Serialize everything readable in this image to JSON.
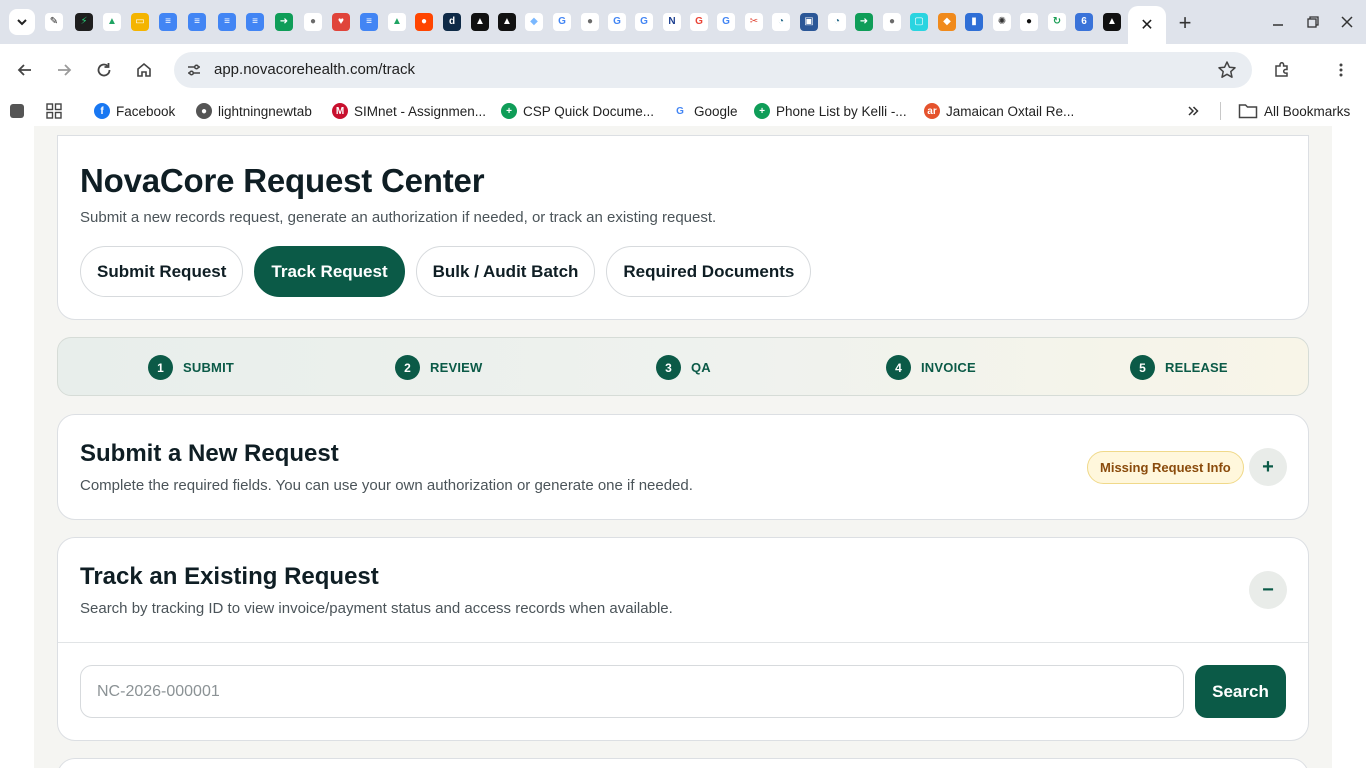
{
  "browser": {
    "tab_favicons": [
      {
        "name": "script-app-icon",
        "glyph": "✎",
        "bg": "#ffffff",
        "fg": "#222222"
      },
      {
        "name": "bolt-app-icon",
        "glyph": "⚡",
        "bg": "#1e1e1e",
        "fg": "#29d17a"
      },
      {
        "name": "google-drive-icon",
        "glyph": "▲",
        "bg": "#ffffff",
        "fg": "#1fa463"
      },
      {
        "name": "google-slides-icon",
        "glyph": "▭",
        "bg": "#f4b400",
        "fg": "#ffffff"
      },
      {
        "name": "google-docs-icon",
        "glyph": "≡",
        "bg": "#4285f4",
        "fg": "#ffffff"
      },
      {
        "name": "google-docs-icon",
        "glyph": "≡",
        "bg": "#4285f4",
        "fg": "#ffffff"
      },
      {
        "name": "google-docs-icon",
        "glyph": "≡",
        "bg": "#4285f4",
        "fg": "#ffffff"
      },
      {
        "name": "google-docs-icon",
        "glyph": "≡",
        "bg": "#4285f4",
        "fg": "#ffffff"
      },
      {
        "name": "google-meet-icon",
        "glyph": "➜",
        "bg": "#0f9d58",
        "fg": "#ffffff"
      },
      {
        "name": "globe-icon",
        "glyph": "●",
        "bg": "#ffffff",
        "fg": "#6b6b6b"
      },
      {
        "name": "calendar-heart-icon",
        "glyph": "♥",
        "bg": "#e0443a",
        "fg": "#ffffff"
      },
      {
        "name": "google-docs-icon",
        "glyph": "≡",
        "bg": "#4285f4",
        "fg": "#ffffff"
      },
      {
        "name": "google-drive-icon",
        "glyph": "▲",
        "bg": "#ffffff",
        "fg": "#1fa463"
      },
      {
        "name": "reddit-icon",
        "glyph": "●",
        "bg": "#ff4500",
        "fg": "#ffffff"
      },
      {
        "name": "d-app-icon",
        "glyph": "d",
        "bg": "#0e2a47",
        "fg": "#ffffff"
      },
      {
        "name": "triangle-app-icon",
        "glyph": "▲",
        "bg": "#111111",
        "fg": "#ffffff"
      },
      {
        "name": "triangle-app-icon",
        "glyph": "▲",
        "bg": "#111111",
        "fg": "#ffffff"
      },
      {
        "name": "gem-app-icon",
        "glyph": "◆",
        "bg": "#ffffff",
        "fg": "#7ab8ff"
      },
      {
        "name": "google-icon",
        "glyph": "G",
        "bg": "#ffffff",
        "fg": "#4285f4"
      },
      {
        "name": "globe-icon",
        "glyph": "●",
        "bg": "#ffffff",
        "fg": "#6b6b6b"
      },
      {
        "name": "google-icon",
        "glyph": "G",
        "bg": "#ffffff",
        "fg": "#4285f4"
      },
      {
        "name": "google-icon",
        "glyph": "G",
        "bg": "#ffffff",
        "fg": "#4285f4"
      },
      {
        "name": "n-app-icon",
        "glyph": "N",
        "bg": "#ffffff",
        "fg": "#1a3d8f"
      },
      {
        "name": "google-icon",
        "glyph": "G",
        "bg": "#ffffff",
        "fg": "#ea4335"
      },
      {
        "name": "google-icon",
        "glyph": "G",
        "bg": "#ffffff",
        "fg": "#4285f4"
      },
      {
        "name": "scissors-app-icon",
        "glyph": "✂",
        "bg": "#ffffff",
        "fg": "#e04a3a"
      },
      {
        "name": "gauge-app-icon",
        "glyph": "◔",
        "bg": "#ffffff",
        "fg": "#2e6f8e"
      },
      {
        "name": "window-app-icon",
        "glyph": "▣",
        "bg": "#2b5797",
        "fg": "#ffffff"
      },
      {
        "name": "gauge-app-icon",
        "glyph": "◔",
        "bg": "#ffffff",
        "fg": "#2e6f8e"
      },
      {
        "name": "google-meet-icon",
        "glyph": "➜",
        "bg": "#0f9d58",
        "fg": "#ffffff"
      },
      {
        "name": "globe-icon",
        "glyph": "●",
        "bg": "#ffffff",
        "fg": "#6b6b6b"
      },
      {
        "name": "square-app-icon",
        "glyph": "▢",
        "bg": "#2ad4e0",
        "fg": "#ffffff"
      },
      {
        "name": "box-app-icon",
        "glyph": "◆",
        "bg": "#f08a1c",
        "fg": "#ffffff"
      },
      {
        "name": "bookmark-app-icon",
        "glyph": "▮",
        "bg": "#2f6fd6",
        "fg": "#ffffff"
      },
      {
        "name": "openai-icon",
        "glyph": "✺",
        "bg": "#ffffff",
        "fg": "#333333"
      },
      {
        "name": "github-icon",
        "glyph": "●",
        "bg": "#ffffff",
        "fg": "#111111"
      },
      {
        "name": "refresh-app-icon",
        "glyph": "↻",
        "bg": "#ffffff",
        "fg": "#1a9e55"
      },
      {
        "name": "six-app-icon",
        "glyph": "6",
        "bg": "#3a73d9",
        "fg": "#ffffff"
      },
      {
        "name": "triangle-app-icon",
        "glyph": "▲",
        "bg": "#111111",
        "fg": "#ffffff"
      }
    ],
    "url": "app.novacorehealth.com/track",
    "bookmarks": [
      {
        "label": "Facebook",
        "glyph": "f",
        "bg": "#1877f2"
      },
      {
        "label": "lightningnewtab",
        "glyph": "●",
        "bg": "#555555"
      },
      {
        "label": "SIMnet - Assignmen...",
        "glyph": "M",
        "bg": "#c8102e"
      },
      {
        "label": "CSP Quick Docume...",
        "glyph": "+",
        "bg": "#0f9d58"
      },
      {
        "label": "Google",
        "glyph": "G",
        "bg": "#ffffff",
        "fg": "#4285f4"
      },
      {
        "label": "Phone List by Kelli -...",
        "glyph": "+",
        "bg": "#0f9d58"
      },
      {
        "label": "Jamaican Oxtail Re...",
        "glyph": "ar",
        "bg": "#e5532d"
      }
    ],
    "all_bookmarks_label": "All Bookmarks"
  },
  "header": {
    "title": "NovaCore Request Center",
    "subtitle": "Submit a new records request, generate an authorization if needed, or track an existing request.",
    "tabs": [
      {
        "label": "Submit Request",
        "active": false
      },
      {
        "label": "Track Request",
        "active": true
      },
      {
        "label": "Bulk / Audit Batch",
        "active": false
      },
      {
        "label": "Required Documents",
        "active": false
      }
    ]
  },
  "steps": [
    {
      "num": "1",
      "label": "SUBMIT"
    },
    {
      "num": "2",
      "label": "REVIEW"
    },
    {
      "num": "3",
      "label": "QA"
    },
    {
      "num": "4",
      "label": "INVOICE"
    },
    {
      "num": "5",
      "label": "RELEASE"
    }
  ],
  "submit_section": {
    "title": "Submit a New Request",
    "subtitle": "Complete the required fields. You can use your own authorization or generate one if needed.",
    "badge": "Missing Request Info",
    "toggle": "+"
  },
  "track_section": {
    "title": "Track an Existing Request",
    "subtitle": "Search by tracking ID to view invoice/payment status and access records when available.",
    "toggle": "−",
    "input_placeholder": "NC-2026-000001",
    "search_label": "Search"
  },
  "colors": {
    "brand": "#0b5a47",
    "badge_bg": "#fff7dc",
    "badge_text": "#8a4b0c"
  }
}
